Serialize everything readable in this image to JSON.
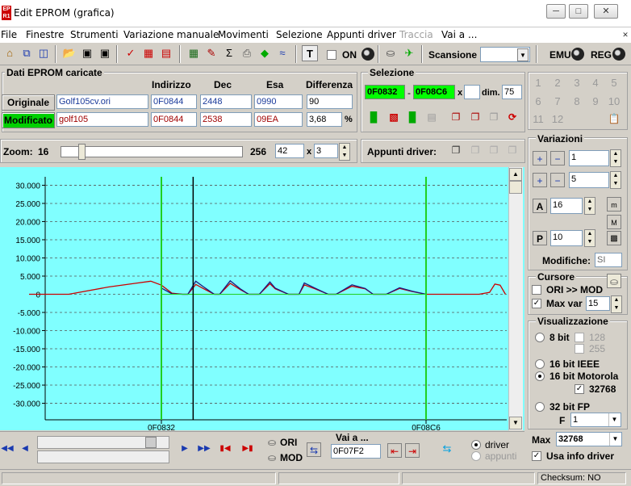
{
  "window": {
    "title": "Edit EPROM (grafica)",
    "app_icon": "EP\nR1"
  },
  "menu": [
    "File",
    "Finestre",
    "Strumenti",
    "Variazione manuale",
    "Movimenti",
    "Selezione",
    "Appunti driver",
    "Traccia",
    "Vai a ..."
  ],
  "toolbar": {
    "on_label": "ON",
    "scansione_label": "Scansione",
    "scansione_value": "",
    "emu_label": "EMU",
    "reg_label": "REG"
  },
  "dati": {
    "title": "Dati EPROM caricate",
    "headers": [
      "Indirizzo",
      "Dec",
      "Esa",
      "Differenza"
    ],
    "originale": {
      "label": "Originale",
      "file": "Golf105cv.ori",
      "indirizzo": "0F0844",
      "dec": "2448",
      "esa": "0990",
      "diff": "90"
    },
    "modificato": {
      "label": "Modificato",
      "file": "golf105",
      "indirizzo": "0F0844",
      "dec": "2538",
      "esa": "09EA",
      "diff": "3,68",
      "unit": "%"
    }
  },
  "selezione": {
    "title": "Selezione",
    "from": "0F0832",
    "to": "0F08C6",
    "x_label": "x",
    "x_value": "",
    "dim_label": "dim.",
    "dim_value": "75"
  },
  "numgrid": [
    "1",
    "2",
    "3",
    "4",
    "5",
    "6",
    "7",
    "8",
    "9",
    "10",
    "11",
    "12"
  ],
  "zoom": {
    "label": "Zoom:",
    "min": "16",
    "max": "256",
    "value": "42",
    "x_label": "x",
    "mult": "3"
  },
  "appunti": {
    "label": "Appunti driver:"
  },
  "variazioni": {
    "title": "Variazioni",
    "val1": "1",
    "val2": "5",
    "val3": "16",
    "val4": "10",
    "modifiche_label": "Modifiche:",
    "modifiche_value": "SI"
  },
  "cursore": {
    "title": "Cursore",
    "ori_mod": "ORI >> MOD",
    "max_var": "Max var",
    "max_var_value": "15"
  },
  "visualizzazione": {
    "title": "Visualizzazione",
    "bit8": "8 bit",
    "v128": "128",
    "v255": "255",
    "ieee": "16 bit IEEE",
    "motorola": "16 bit Motorola",
    "v32768": "32768",
    "fp32": "32 bit FP",
    "f_label": "F",
    "f_value": "1"
  },
  "max": {
    "label": "Max",
    "value": "32768",
    "usa_info": "Usa info driver"
  },
  "bottom": {
    "ori": "ORI",
    "mod": "MOD",
    "vai_a_label": "Vai a ...",
    "vai_a_value": "0F07F2",
    "driver": "driver",
    "appunti": "appunti"
  },
  "status": {
    "checksum": "Checksum: NO"
  },
  "colors": {
    "chart_bg": "#80ffff",
    "green_on": "#00d000",
    "original_series": "#cc0000",
    "modified_series": "#1a1a80",
    "marker": "#20d020"
  },
  "chart_data": {
    "type": "line",
    "ylim": [
      -32768,
      32768
    ],
    "yticks": [
      30000,
      25000,
      20000,
      15000,
      10000,
      5000,
      0,
      -5000,
      -10000,
      -15000,
      -20000,
      -25000,
      -30000
    ],
    "ytick_labels": [
      "30.000",
      "25.000",
      "20.000",
      "15.000",
      "10.000",
      "5.000",
      "0",
      "-5.000",
      "-10.000",
      "-15.000",
      "-20.000",
      "-25.000",
      "-30.000"
    ],
    "grid": true,
    "x_markers": [
      {
        "label": "0F0832",
        "pos": 0.0
      },
      {
        "label": "0F08C6",
        "pos": 1.0
      }
    ],
    "cursor_pos": 0.12,
    "series": [
      {
        "role": "original",
        "x": [
          -0.5,
          -0.35,
          -0.2,
          -0.1,
          -0.04,
          0,
          0.04,
          0.08,
          0.1,
          0.13,
          0.16,
          0.2,
          0.22,
          0.26,
          0.3,
          0.33,
          0.37,
          0.41,
          0.43,
          0.48,
          0.52,
          0.54,
          0.58,
          0.63,
          0.66,
          0.72,
          0.77,
          0.8,
          0.85,
          0.9,
          0.95,
          1.0,
          1.04,
          1.1,
          1.2,
          1.24,
          1.26,
          1.28,
          1.3
        ],
        "y": [
          0,
          0,
          2000,
          3000,
          3600,
          2500,
          300,
          0,
          0,
          2700,
          1500,
          0,
          0,
          3000,
          1200,
          0,
          0,
          2900,
          1500,
          0,
          0,
          2600,
          1500,
          0,
          0,
          2200,
          1500,
          0,
          0,
          1600,
          700,
          0,
          0,
          0,
          0,
          500,
          2800,
          2500,
          0
        ]
      },
      {
        "role": "modified",
        "x": [
          0,
          0.04,
          0.08,
          0.1,
          0.13,
          0.16,
          0.2,
          0.22,
          0.26,
          0.3,
          0.33,
          0.37,
          0.41,
          0.43,
          0.48,
          0.52,
          0.54,
          0.58,
          0.63,
          0.66,
          0.72,
          0.77,
          0.8,
          0.85,
          0.9,
          0.95,
          1.0
        ],
        "y": [
          1700,
          100,
          0,
          0,
          3600,
          2000,
          0,
          0,
          3700,
          1400,
          0,
          0,
          3400,
          1700,
          0,
          0,
          3100,
          1700,
          0,
          0,
          2600,
          1600,
          0,
          0,
          1800,
          800,
          0
        ]
      }
    ]
  }
}
